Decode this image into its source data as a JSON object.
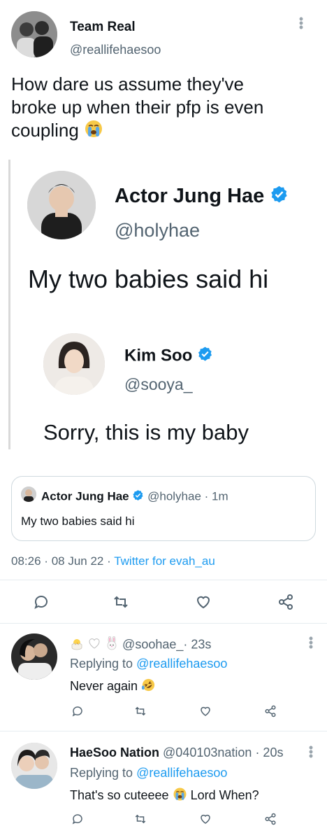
{
  "main_tweet": {
    "display_name": "Team Real",
    "handle": "@reallifehaesoo",
    "text": "How dare us assume they've broke up when their pfp is even coupling",
    "text_line1": "How dare us assume they've",
    "text_line2": "broke up when their pfp is even",
    "text_line3": "coupling",
    "emoji": "crying-face"
  },
  "image": {
    "post1": {
      "display_name": "Actor Jung Hae",
      "handle": "@holyhae",
      "text": "My two babies said hi"
    },
    "post2": {
      "display_name": "Kim Soo",
      "handle": "@sooya_",
      "text": "Sorry, this is my baby"
    }
  },
  "quoted": {
    "display_name": "Actor Jung Hae",
    "handle": "@holyhae",
    "time": "· 1m",
    "text": "My two babies said hi"
  },
  "timestamp": {
    "time": "08:26",
    "sep1": "·",
    "date": "08 Jun 22",
    "sep2": "·",
    "source": "Twitter for evah_au"
  },
  "actions": [
    "reply-icon",
    "retweet-icon",
    "like-icon",
    "share-icon"
  ],
  "replies": [
    {
      "display_emojis": [
        "hatching-chick",
        "white-heart",
        "rabbit-face"
      ],
      "handle": "@soohae_",
      "time": "· 23s",
      "replying_prefix": "Replying to",
      "replying_to": "@reallifehaesoo",
      "text": "Never again",
      "emoji": "rolling-on-floor-laughing"
    },
    {
      "display_name": "HaeSoo Nation",
      "handle": "@040103nation",
      "time": "· 20s",
      "replying_prefix": "Replying to",
      "replying_to": "@reallifehaesoo",
      "text": "That's so cuteeee",
      "text_after": "Lord When?",
      "emoji": "crying-face"
    }
  ],
  "colors": {
    "accent": "#1d9bf0",
    "secondary_text": "#536471",
    "icon": "#536471"
  }
}
